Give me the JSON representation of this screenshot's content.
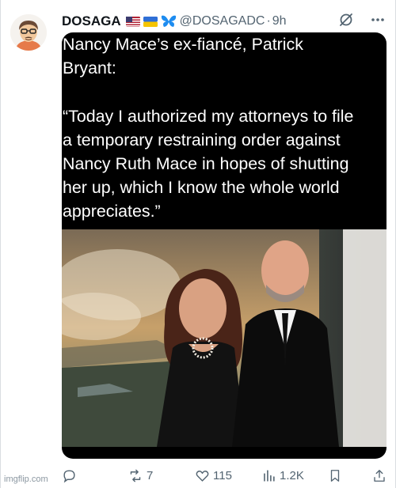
{
  "tweet": {
    "display_name": "DOSAGA",
    "handle": "@DOSAGADC",
    "separator": "·",
    "time": "9h",
    "quote_text": "Nancy Mace’s ex-fiancé, Patrick\nBryant:\n\n“Today I authorized my attorneys to file\na temporary restraining order against\nNancy Ruth Mace in hopes of shutting\nher up, which I know the whole world\nappreciates.”"
  },
  "header_icons": [
    "us-flag-icon",
    "ukraine-flag-icon",
    "blue-butterfly-icon",
    "grok-icon",
    "more-icon"
  ],
  "actions": {
    "reply": {
      "icon": "reply-icon",
      "count": ""
    },
    "repost": {
      "icon": "repost-icon",
      "count": "7"
    },
    "like": {
      "icon": "like-icon",
      "count": "115"
    },
    "views": {
      "icon": "views-icon",
      "count": "1.2K"
    },
    "bookmark": {
      "icon": "bookmark-icon",
      "count": ""
    },
    "share": {
      "icon": "share-icon",
      "count": ""
    }
  },
  "watermark": "imgflip.com",
  "colors": {
    "text": "#0f1419",
    "secondary": "#536471",
    "media_bg": "#000000"
  }
}
